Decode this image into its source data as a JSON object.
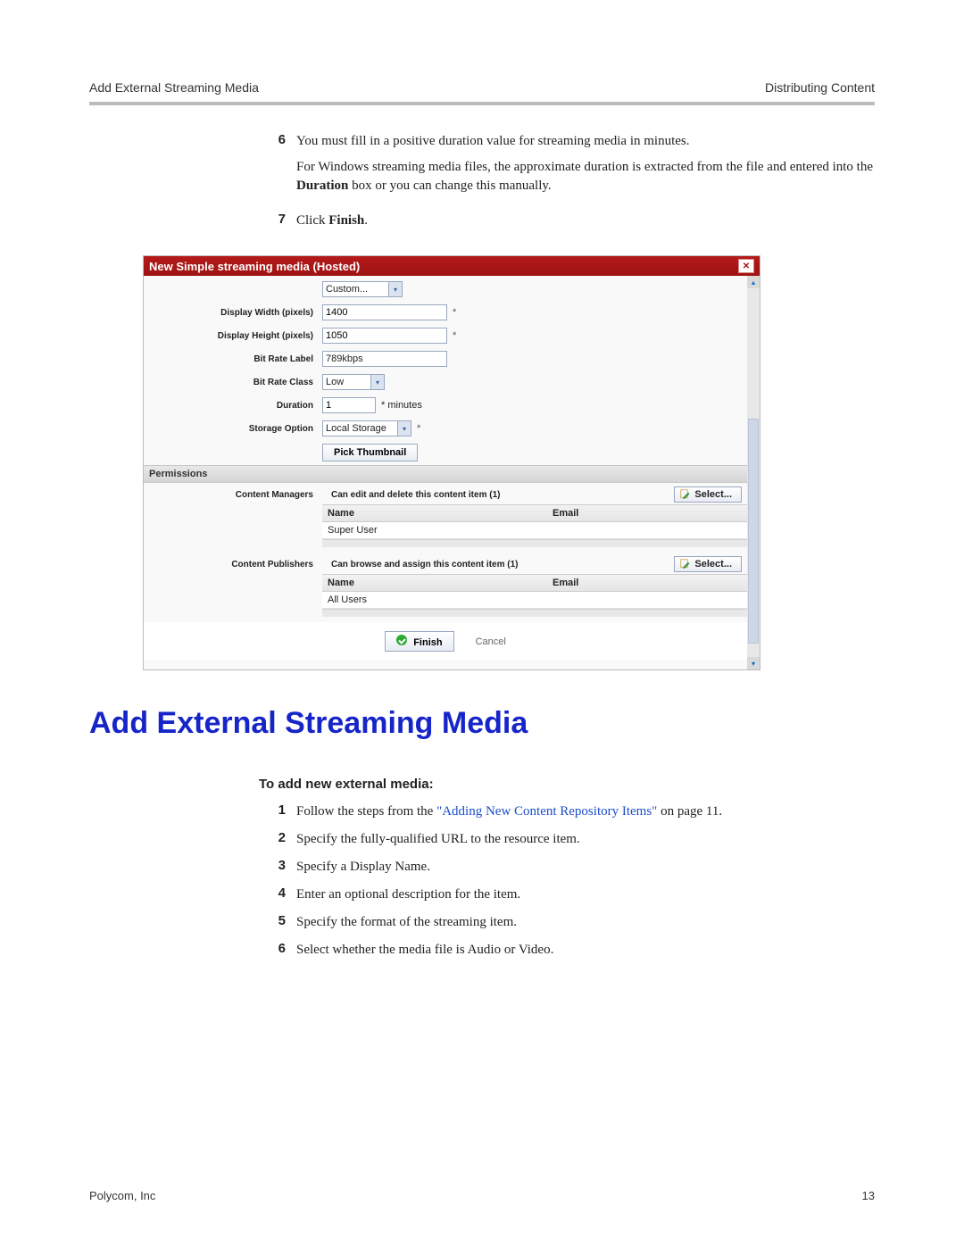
{
  "header": {
    "left": "Add External Streaming Media",
    "right": "Distributing Content"
  },
  "steps_upper": [
    {
      "num": "6",
      "paragraphs": [
        "You must fill in a positive duration value for streaming media in minutes.",
        "For Windows streaming media files, the approximate duration is extracted from the file and entered into the __B__Duration__/B__ box or you can change this manually."
      ]
    },
    {
      "num": "7",
      "paragraphs": [
        "Click __B__Finish__/B__."
      ]
    }
  ],
  "dialog": {
    "title": "New Simple streaming media (Hosted)",
    "fields": {
      "video_size_label": "",
      "video_size_value": "Custom...",
      "width_label": "Display Width (pixels)",
      "width_value": "1400",
      "height_label": "Display Height (pixels)",
      "height_value": "1050",
      "bitrate_label_label": "Bit Rate Label",
      "bitrate_label_value": "789kbps",
      "bitrate_class_label": "Bit Rate Class",
      "bitrate_class_value": "Low",
      "duration_label": "Duration",
      "duration_value": "1",
      "duration_unit": "* minutes",
      "storage_label": "Storage Option",
      "storage_value": "Local Storage",
      "asterisk": "*",
      "pick_thumb": "Pick Thumbnail"
    },
    "permissions_header": "Permissions",
    "managers": {
      "label": "Content Managers",
      "desc": "Can edit and delete this content item  (1)",
      "select": "Select...",
      "col_name": "Name",
      "col_email": "Email",
      "rows": [
        {
          "name": "Super User",
          "email": ""
        }
      ]
    },
    "publishers": {
      "label": "Content Publishers",
      "desc": "Can browse and assign this content item  (1)",
      "select": "Select...",
      "col_name": "Name",
      "col_email": "Email",
      "rows": [
        {
          "name": "All Users",
          "email": ""
        }
      ]
    },
    "finish": "Finish",
    "cancel": "Cancel"
  },
  "section_title": "Add External Streaming Media",
  "sub_heading": "To add new external media:",
  "steps_lower": [
    {
      "num": "1",
      "text_before": "Follow the steps from the ",
      "link": "\"Adding New Content Repository Items\"",
      "text_after": " on page 11."
    },
    {
      "num": "2",
      "text": "Specify the fully-qualified URL to the resource item."
    },
    {
      "num": "3",
      "text": "Specify a Display Name."
    },
    {
      "num": "4",
      "text": "Enter an optional description for the item."
    },
    {
      "num": "5",
      "text": "Specify the format of the streaming item."
    },
    {
      "num": "6",
      "text": "Select whether the media file is Audio or Video."
    }
  ],
  "footer": {
    "left": "Polycom, Inc",
    "right": "13"
  }
}
